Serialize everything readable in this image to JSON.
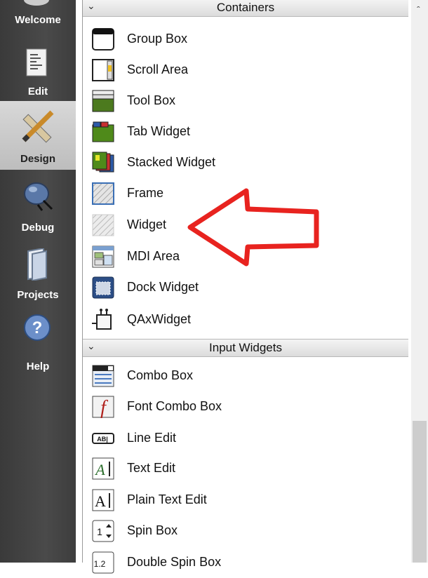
{
  "modes": [
    {
      "label": "Welcome",
      "icon": "welcome-icon"
    },
    {
      "label": "Edit",
      "icon": "edit-document-icon"
    },
    {
      "label": "Design",
      "icon": "design-pencil-icon"
    },
    {
      "label": "Debug",
      "icon": "debug-bug-icon"
    },
    {
      "label": "Projects",
      "icon": "projects-book-icon"
    },
    {
      "label": "Help",
      "icon": "help-question-icon"
    }
  ],
  "containers": {
    "title": "Containers",
    "items": [
      {
        "label": "Group Box",
        "icon": "group-box-icon"
      },
      {
        "label": "Scroll Area",
        "icon": "scroll-area-icon"
      },
      {
        "label": "Tool Box",
        "icon": "tool-box-icon"
      },
      {
        "label": "Tab Widget",
        "icon": "tab-widget-icon"
      },
      {
        "label": "Stacked Widget",
        "icon": "stacked-widget-icon"
      },
      {
        "label": "Frame",
        "icon": "frame-icon"
      },
      {
        "label": "Widget",
        "icon": "widget-icon"
      },
      {
        "label": "MDI Area",
        "icon": "mdi-area-icon"
      },
      {
        "label": "Dock Widget",
        "icon": "dock-widget-icon"
      },
      {
        "label": "QAxWidget",
        "icon": "qaxwidget-icon"
      }
    ]
  },
  "input_widgets": {
    "title": "Input Widgets",
    "items": [
      {
        "label": "Combo Box",
        "icon": "combo-box-icon"
      },
      {
        "label": "Font Combo Box",
        "icon": "font-combo-box-icon"
      },
      {
        "label": "Line Edit",
        "icon": "line-edit-icon"
      },
      {
        "label": "Text Edit",
        "icon": "text-edit-icon"
      },
      {
        "label": "Plain Text Edit",
        "icon": "plain-text-edit-icon"
      },
      {
        "label": "Spin Box",
        "icon": "spin-box-icon"
      },
      {
        "label": "Double Spin Box",
        "icon": "double-spin-box-icon"
      }
    ]
  },
  "annotation": {
    "color": "#e8231f",
    "icon": "red-arrow-icon"
  }
}
